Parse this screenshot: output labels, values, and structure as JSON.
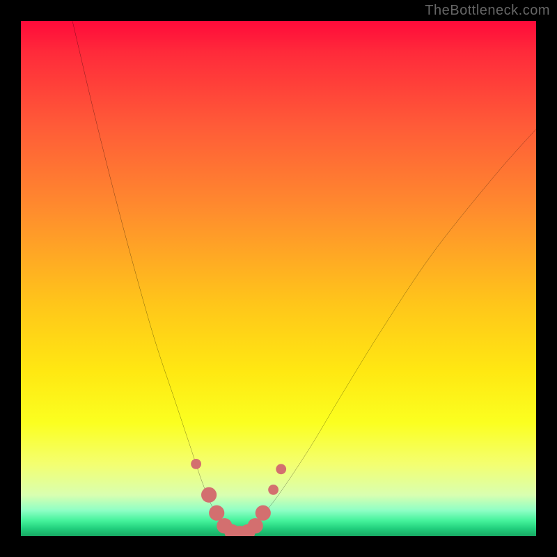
{
  "watermark": "TheBottleneck.com",
  "chart_data": {
    "type": "line",
    "title": "",
    "xlabel": "",
    "ylabel": "",
    "xlim": [
      0,
      100
    ],
    "ylim": [
      0,
      100
    ],
    "background": {
      "type": "vertical-gradient",
      "stops": [
        {
          "pos": 0,
          "color": "#ff0a3a"
        },
        {
          "pos": 36,
          "color": "#ff8a2e"
        },
        {
          "pos": 68,
          "color": "#ffe812"
        },
        {
          "pos": 92,
          "color": "#d9ffb0"
        },
        {
          "pos": 100,
          "color": "#18a863"
        }
      ]
    },
    "series": [
      {
        "name": "bottleneck-curve",
        "color": "#000000",
        "x": [
          10,
          14,
          18,
          22,
          26,
          30,
          33,
          35,
          37,
          39,
          40,
          42,
          44,
          46,
          50,
          56,
          62,
          70,
          80,
          92,
          100
        ],
        "y": [
          100,
          83,
          67,
          52,
          38,
          26,
          17,
          11,
          6,
          3,
          1,
          0,
          1,
          3,
          8,
          17,
          27,
          40,
          55,
          70,
          79
        ]
      }
    ],
    "markers": {
      "name": "highlight-dots",
      "color": "#d36f6f",
      "radius_small": 1.0,
      "radius_large": 1.5,
      "points": [
        {
          "x": 34.0,
          "y": 14.0,
          "r": "small"
        },
        {
          "x": 36.5,
          "y": 8.0,
          "r": "large"
        },
        {
          "x": 38.0,
          "y": 4.5,
          "r": "large"
        },
        {
          "x": 39.5,
          "y": 2.0,
          "r": "large"
        },
        {
          "x": 41.0,
          "y": 0.8,
          "r": "large"
        },
        {
          "x": 42.5,
          "y": 0.5,
          "r": "large"
        },
        {
          "x": 44.0,
          "y": 0.8,
          "r": "large"
        },
        {
          "x": 45.5,
          "y": 2.0,
          "r": "large"
        },
        {
          "x": 47.0,
          "y": 4.5,
          "r": "large"
        },
        {
          "x": 49.0,
          "y": 9.0,
          "r": "small"
        },
        {
          "x": 50.5,
          "y": 13.0,
          "r": "small"
        }
      ]
    }
  }
}
